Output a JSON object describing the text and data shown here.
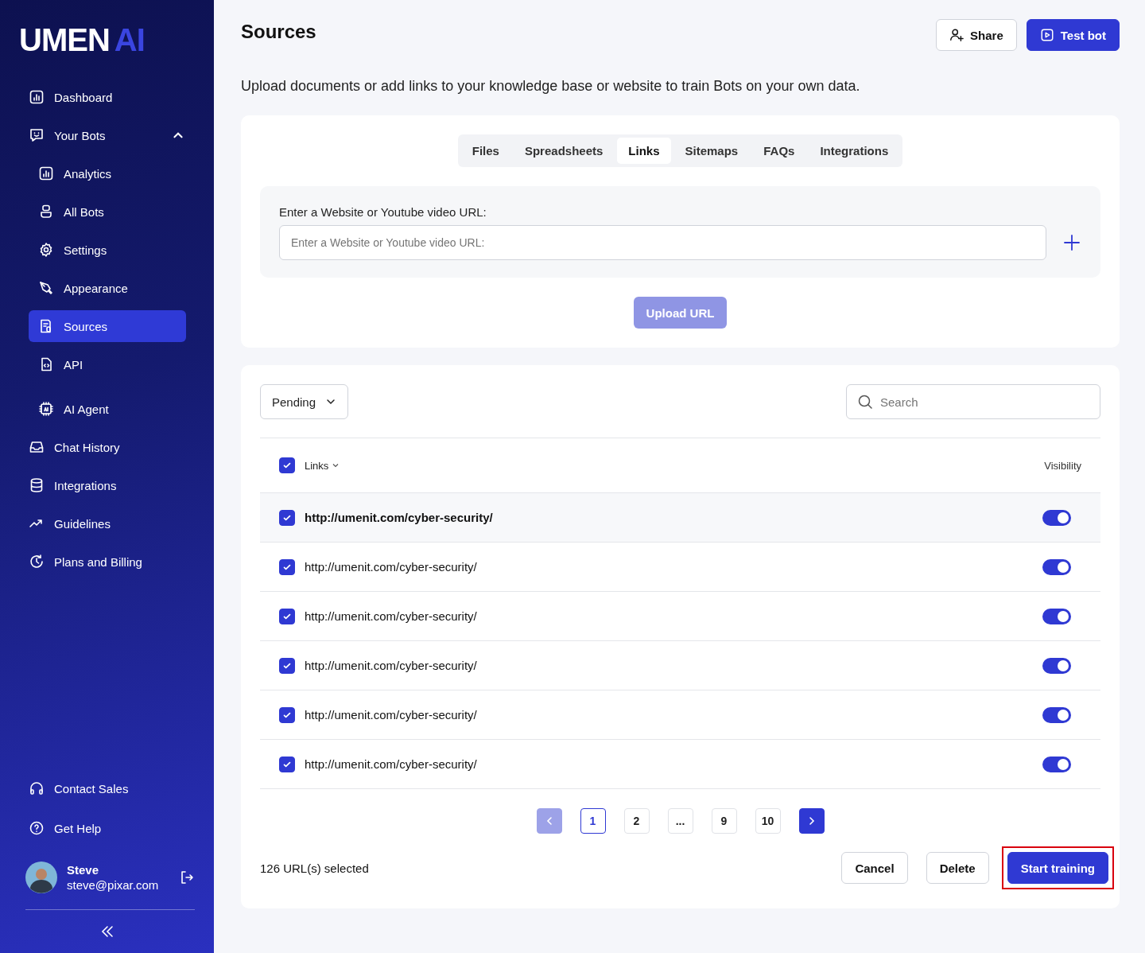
{
  "sidebar": {
    "logo": {
      "main": "UMEN",
      "accent": "AI"
    },
    "nav": [
      {
        "label": "Dashboard",
        "selected": false
      },
      {
        "label": "Your Bots",
        "selected": false,
        "expanded": true,
        "children": [
          {
            "label": "Analytics",
            "selected": false
          },
          {
            "label": "All Bots",
            "selected": false
          },
          {
            "label": "Settings",
            "selected": false
          },
          {
            "label": "Appearance",
            "selected": false
          },
          {
            "label": "Sources",
            "selected": true
          },
          {
            "label": "API",
            "selected": false
          },
          {
            "label": "AI Agent",
            "selected": false
          }
        ]
      },
      {
        "label": "Chat History",
        "selected": false
      },
      {
        "label": "Integrations",
        "selected": false
      },
      {
        "label": "Guidelines",
        "selected": false
      },
      {
        "label": "Plans and Billing",
        "selected": false
      }
    ],
    "footer": [
      {
        "label": "Contact Sales"
      },
      {
        "label": "Get Help"
      }
    ],
    "user": {
      "name": "Steve",
      "email": "steve@pixar.com"
    }
  },
  "header": {
    "title": "Sources",
    "buttons": [
      {
        "label": "Share",
        "kind": "secondary"
      },
      {
        "label": "Test bot",
        "kind": "primary"
      }
    ]
  },
  "description": "Upload documents or add links to your knowledge base or website to train Bots on your own data.",
  "tabs": [
    {
      "label": "Files",
      "selected": false
    },
    {
      "label": "Spreadsheets",
      "selected": false
    },
    {
      "label": "Links",
      "selected": true
    },
    {
      "label": "Sitemaps",
      "selected": false
    },
    {
      "label": "FAQs",
      "selected": false
    },
    {
      "label": "Integrations",
      "selected": false
    }
  ],
  "url_form": {
    "label": "Enter a Website or Youtube video URL:",
    "placeholder": "Enter a Website or Youtube video URL:",
    "upload_button": {
      "label": "Upload URL",
      "disabled": true
    }
  },
  "filter": {
    "value": "Pending"
  },
  "search": {
    "placeholder": "Search"
  },
  "table": {
    "all_checked": true,
    "columns": [
      "Links",
      "Visibility"
    ],
    "rows": [
      {
        "url": "http://umenit.com/cyber-security/",
        "checked": true,
        "visible": true,
        "highlighted": true
      },
      {
        "url": "http://umenit.com/cyber-security/",
        "checked": true,
        "visible": true,
        "highlighted": false
      },
      {
        "url": "http://umenit.com/cyber-security/",
        "checked": true,
        "visible": true,
        "highlighted": false
      },
      {
        "url": "http://umenit.com/cyber-security/",
        "checked": true,
        "visible": true,
        "highlighted": false
      },
      {
        "url": "http://umenit.com/cyber-security/",
        "checked": true,
        "visible": true,
        "highlighted": false
      },
      {
        "url": "http://umenit.com/cyber-security/",
        "checked": true,
        "visible": true,
        "highlighted": false
      }
    ]
  },
  "pagination": {
    "prev_disabled": true,
    "next_disabled": false,
    "pages": [
      {
        "label": "1",
        "selected": true
      },
      {
        "label": "2",
        "selected": false
      },
      {
        "label": "...",
        "selected": false
      },
      {
        "label": "9",
        "selected": false
      },
      {
        "label": "10",
        "selected": false
      }
    ]
  },
  "footer": {
    "summary": "126 URL(s) selected",
    "buttons": [
      {
        "label": "Cancel",
        "kind": "secondary"
      },
      {
        "label": "Delete",
        "kind": "secondary"
      },
      {
        "label": "Start training",
        "kind": "primary",
        "highlighted": true
      }
    ]
  }
}
